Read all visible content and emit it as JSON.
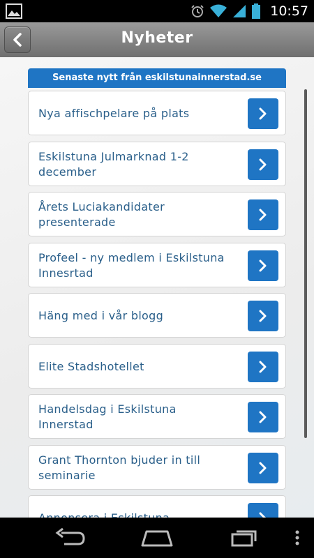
{
  "status": {
    "time": "10:57"
  },
  "header": {
    "title": "Nyheter"
  },
  "section": {
    "label": "Senaste nytt från eskilstunainnerstad.se"
  },
  "news": [
    {
      "label": "Nya affischpelare på plats"
    },
    {
      "label": "Eskilstuna Julmarknad 1-2 december"
    },
    {
      "label": "Årets Luciakandidater presenterade"
    },
    {
      "label": "Profeel - ny medlem i Eskilstuna Innesrtad"
    },
    {
      "label": "Häng med i vår blogg"
    },
    {
      "label": "Elite Stadshotellet"
    },
    {
      "label": "Handelsdag i Eskilstuna Innerstad"
    },
    {
      "label": "Grant Thornton bjuder in till seminarie"
    },
    {
      "label": "Annonsera i Eskilstuna"
    }
  ],
  "colors": {
    "accent": "#1f75c4",
    "item_text": "#2a5f8a",
    "header_bg": "#7f7f7f"
  }
}
